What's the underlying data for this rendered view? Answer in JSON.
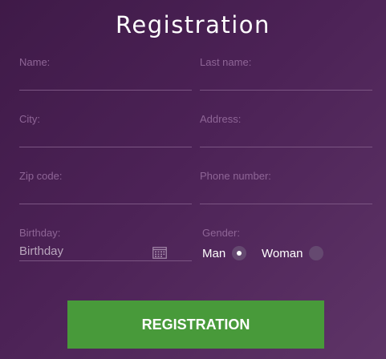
{
  "form": {
    "title": "Registration",
    "fields": {
      "name": {
        "label": "Name:",
        "value": ""
      },
      "last_name": {
        "label": "Last name:",
        "value": ""
      },
      "city": {
        "label": "City:",
        "value": ""
      },
      "address": {
        "label": "Address:",
        "value": ""
      },
      "zip_code": {
        "label": "Zip code:",
        "value": ""
      },
      "phone_number": {
        "label": "Phone number:",
        "value": ""
      },
      "birthday": {
        "label": "Birthday:",
        "placeholder": "Birthday",
        "icon": "calendar-icon"
      }
    },
    "gender": {
      "label": "Gender:",
      "options": [
        {
          "label": "Man",
          "selected": true
        },
        {
          "label": "Woman",
          "selected": false
        }
      ]
    },
    "submit_label": "REGISTRATION"
  },
  "colors": {
    "background_start": "#3f1a48",
    "background_end": "#5e3467",
    "label": "#8e6596",
    "button": "#489a3a"
  }
}
